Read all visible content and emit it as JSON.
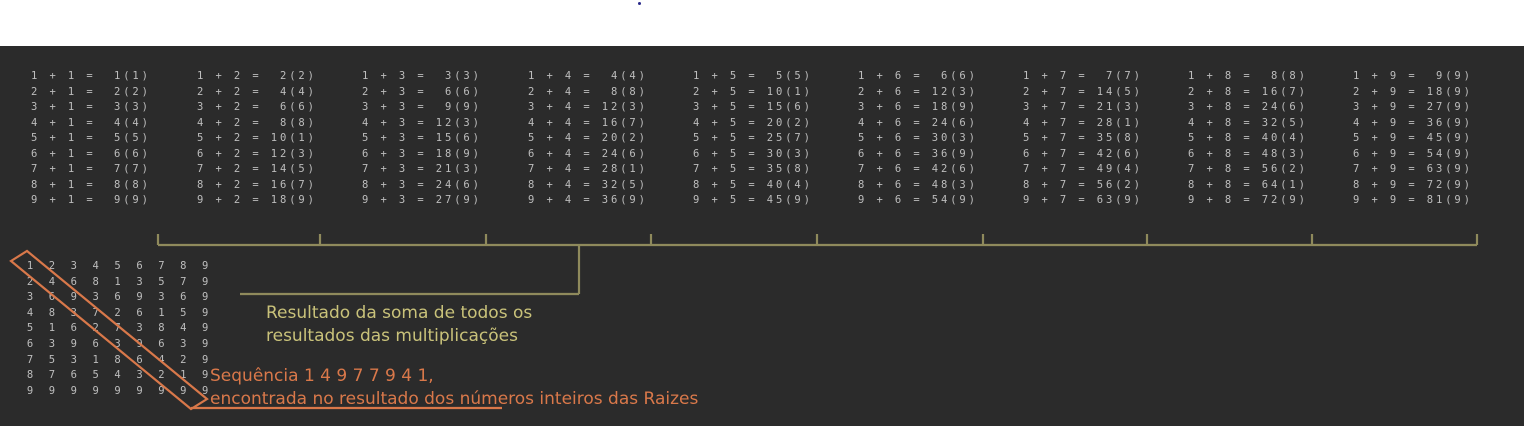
{
  "colors": {
    "bracket": "#8f8a5c",
    "note_olive": "#c9c27a",
    "note_orange": "#d9784a",
    "terminal_bg": "#2b2b2b",
    "text": "#bdbdbd"
  },
  "table_rows": [
    [
      "1 + 1 =  1(1)",
      "1 + 2 =  2(2)",
      "1 + 3 =  3(3)",
      "1 + 4 =  4(4)",
      "1 + 5 =  5(5)",
      "1 + 6 =  6(6)",
      "1 + 7 =  7(7)",
      "1 + 8 =  8(8)",
      "1 + 9 =  9(9)"
    ],
    [
      "2 + 1 =  2(2)",
      "2 + 2 =  4(4)",
      "2 + 3 =  6(6)",
      "2 + 4 =  8(8)",
      "2 + 5 = 10(1)",
      "2 + 6 = 12(3)",
      "2 + 7 = 14(5)",
      "2 + 8 = 16(7)",
      "2 + 9 = 18(9)"
    ],
    [
      "3 + 1 =  3(3)",
      "3 + 2 =  6(6)",
      "3 + 3 =  9(9)",
      "3 + 4 = 12(3)",
      "3 + 5 = 15(6)",
      "3 + 6 = 18(9)",
      "3 + 7 = 21(3)",
      "3 + 8 = 24(6)",
      "3 + 9 = 27(9)"
    ],
    [
      "4 + 1 =  4(4)",
      "4 + 2 =  8(8)",
      "4 + 3 = 12(3)",
      "4 + 4 = 16(7)",
      "4 + 5 = 20(2)",
      "4 + 6 = 24(6)",
      "4 + 7 = 28(1)",
      "4 + 8 = 32(5)",
      "4 + 9 = 36(9)"
    ],
    [
      "5 + 1 =  5(5)",
      "5 + 2 = 10(1)",
      "5 + 3 = 15(6)",
      "5 + 4 = 20(2)",
      "5 + 5 = 25(7)",
      "5 + 6 = 30(3)",
      "5 + 7 = 35(8)",
      "5 + 8 = 40(4)",
      "5 + 9 = 45(9)"
    ],
    [
      "6 + 1 =  6(6)",
      "6 + 2 = 12(3)",
      "6 + 3 = 18(9)",
      "6 + 4 = 24(6)",
      "6 + 5 = 30(3)",
      "6 + 6 = 36(9)",
      "6 + 7 = 42(6)",
      "6 + 8 = 48(3)",
      "6 + 9 = 54(9)"
    ],
    [
      "7 + 1 =  7(7)",
      "7 + 2 = 14(5)",
      "7 + 3 = 21(3)",
      "7 + 4 = 28(1)",
      "7 + 5 = 35(8)",
      "7 + 6 = 42(6)",
      "7 + 7 = 49(4)",
      "7 + 8 = 56(2)",
      "7 + 9 = 63(9)"
    ],
    [
      "8 + 1 =  8(8)",
      "8 + 2 = 16(7)",
      "8 + 3 = 24(6)",
      "8 + 4 = 32(5)",
      "8 + 5 = 40(4)",
      "8 + 6 = 48(3)",
      "8 + 7 = 56(2)",
      "8 + 8 = 64(1)",
      "8 + 9 = 72(9)"
    ],
    [
      "9 + 1 =  9(9)",
      "9 + 2 = 18(9)",
      "9 + 3 = 27(9)",
      "9 + 4 = 36(9)",
      "9 + 5 = 45(9)",
      "9 + 6 = 54(9)",
      "9 + 7 = 63(9)",
      "9 + 8 = 72(9)",
      "9 + 9 = 81(9)"
    ]
  ],
  "grid_rows": [
    [
      "1",
      "2",
      "3",
      "4",
      "5",
      "6",
      "7",
      "8",
      "9"
    ],
    [
      "2",
      "4",
      "6",
      "8",
      "1",
      "3",
      "5",
      "7",
      "9"
    ],
    [
      "3",
      "6",
      "9",
      "3",
      "6",
      "9",
      "3",
      "6",
      "9"
    ],
    [
      "4",
      "8",
      "3",
      "7",
      "2",
      "6",
      "1",
      "5",
      "9"
    ],
    [
      "5",
      "1",
      "6",
      "2",
      "7",
      "3",
      "8",
      "4",
      "9"
    ],
    [
      "6",
      "3",
      "9",
      "6",
      "3",
      "9",
      "6",
      "3",
      "9"
    ],
    [
      "7",
      "5",
      "3",
      "1",
      "8",
      "6",
      "4",
      "2",
      "9"
    ],
    [
      "8",
      "7",
      "6",
      "5",
      "4",
      "3",
      "2",
      "1",
      "9"
    ],
    [
      "9",
      "9",
      "9",
      "9",
      "9",
      "9",
      "9",
      "9",
      "9"
    ]
  ],
  "annotations": {
    "sum_note_line1": "Resultado da soma de todos os",
    "sum_note_line2": "resultados das multiplicações",
    "sequence_note_line1": "Sequência 1 4 9 7 7 9 4 1,",
    "sequence_note_line2": "encontrada no resultado dos números inteiros das Raizes"
  }
}
